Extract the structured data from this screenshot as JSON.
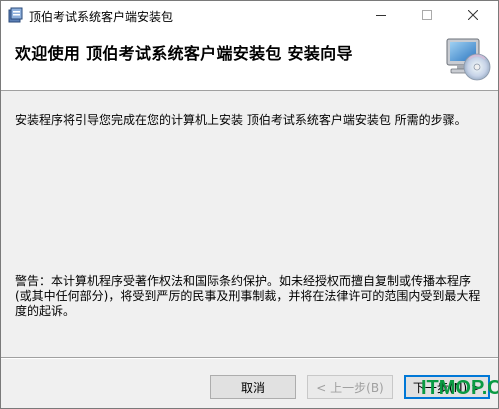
{
  "window": {
    "title": "顶伯考试系统客户端安装包"
  },
  "header": {
    "title": "欢迎使用  顶伯考试系统客户端安装包  安装向导"
  },
  "body": {
    "intro": "安装程序将引导您完成在您的计算机上安装  顶伯考试系统客户端安装包  所需的步骤。",
    "warning": "警告：本计算机程序受著作权法和国际条约保护。如未经授权而擅自复制或传播本程序(或其中任何部分)，将受到严厉的民事及刑事制裁，并将在法律许可的范围内受到最大程度的起诉。"
  },
  "buttons": {
    "cancel": "取消",
    "back": "< 上一步(B)",
    "next": "下一步(N) >"
  },
  "watermark": {
    "text": "ITMOP.COM"
  },
  "colors": {
    "accent": "#0078d7",
    "watermark": "#0a9a42"
  }
}
